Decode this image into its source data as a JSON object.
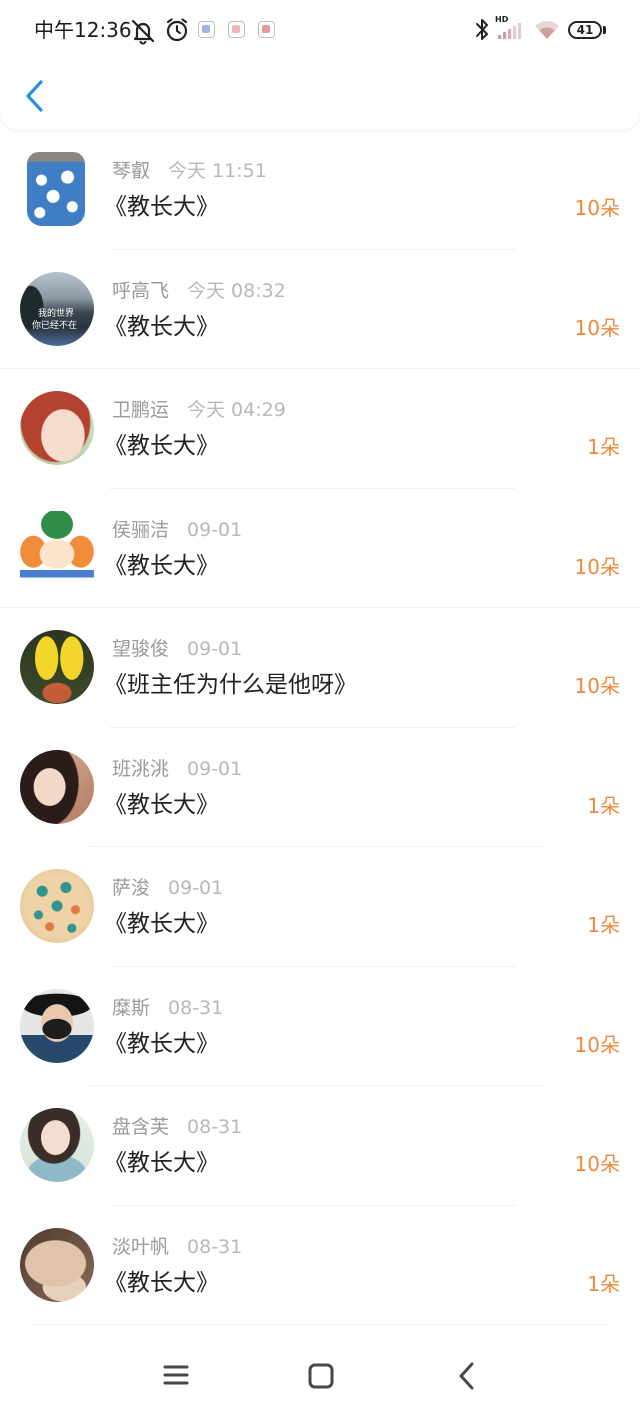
{
  "status_bar": {
    "time": "中午12:36",
    "network_label": "HD",
    "battery_level": "41",
    "icons": [
      "bell-off-icon",
      "alarm-icon",
      "app-notification-icon",
      "app-notification-icon",
      "app-notification-icon",
      "bluetooth-icon",
      "signal-icon",
      "wifi-icon",
      "battery-icon"
    ]
  },
  "header": {
    "back_icon": "chevron-left-icon"
  },
  "colors": {
    "accent": "#2b8fe6",
    "count": "#f0893d",
    "name": "#9a9a9a",
    "time": "#b8b8b8",
    "title": "#222222"
  },
  "rows": [
    {
      "name": "琴叡",
      "time": "今天 11:51",
      "title": "《教长大》",
      "count": "10朵"
    },
    {
      "name": "呼高飞",
      "time": "今天 08:32",
      "title": "《教长大》",
      "count": "10朵",
      "avatar_text": [
        "我的世界",
        "你已经不在"
      ]
    },
    {
      "name": "卫鹏运",
      "time": "今天 04:29",
      "title": "《教长大》",
      "count": "1朵"
    },
    {
      "name": "侯骊洁",
      "time": "09-01",
      "title": "《教长大》",
      "count": "10朵"
    },
    {
      "name": "望骏俊",
      "time": "09-01",
      "title": "《班主任为什么是他呀》",
      "count": "10朵"
    },
    {
      "name": "班洮洮",
      "time": "09-01",
      "title": "《教长大》",
      "count": "1朵"
    },
    {
      "name": "萨浚",
      "time": "09-01",
      "title": "《教长大》",
      "count": "1朵"
    },
    {
      "name": "糜斯",
      "time": "08-31",
      "title": "《教长大》",
      "count": "10朵"
    },
    {
      "name": "盘含芙",
      "time": "08-31",
      "title": "《教长大》",
      "count": "10朵"
    },
    {
      "name": "淡叶帆",
      "time": "08-31",
      "title": "《教长大》",
      "count": "1朵"
    }
  ],
  "nav_bar": {
    "icons": [
      "menu-icon",
      "home-icon",
      "back-icon"
    ]
  }
}
